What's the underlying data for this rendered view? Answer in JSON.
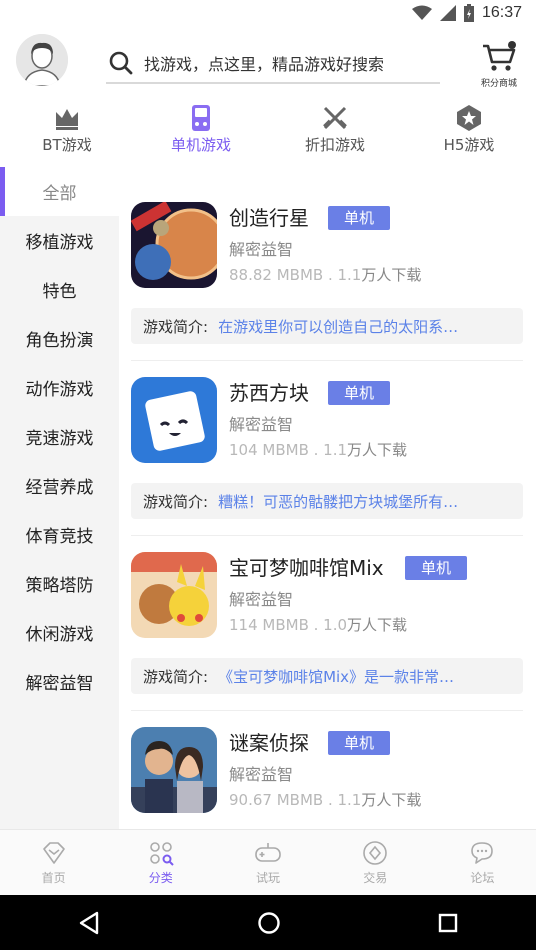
{
  "status": {
    "time": "16:37"
  },
  "header": {
    "search_placeholder": "找游戏，点这里，精品游戏好搜索",
    "cart_label": "积分商城"
  },
  "tabs": [
    {
      "label": "BT游戏",
      "icon": "crown-icon"
    },
    {
      "label": "单机游戏",
      "icon": "gameboy-icon",
      "active": true
    },
    {
      "label": "折扣游戏",
      "icon": "crossed-swords-icon"
    },
    {
      "label": "H5游戏",
      "icon": "hexagon-star-icon"
    }
  ],
  "sidebar": {
    "items": [
      {
        "label": "全部",
        "active": true
      },
      {
        "label": "移植游戏"
      },
      {
        "label": "特色"
      },
      {
        "label": "角色扮演"
      },
      {
        "label": "动作游戏"
      },
      {
        "label": "竞速游戏"
      },
      {
        "label": "经营养成"
      },
      {
        "label": "体育竞技"
      },
      {
        "label": "策略塔防"
      },
      {
        "label": "休闲游戏"
      },
      {
        "label": "解密益智"
      }
    ]
  },
  "games": [
    {
      "title": "创造行星",
      "badge": "单机",
      "category": "解密益智",
      "size": "88.82 MBMB . 1.1",
      "downloads": "万人下载",
      "intro_label": "游戏简介:",
      "intro": "在游戏里你可以创造自己的太阳系…"
    },
    {
      "title": "苏西方块",
      "badge": "单机",
      "category": "解密益智",
      "size": "104 MBMB . 1.1",
      "downloads": "万人下载",
      "intro_label": "游戏简介:",
      "intro": "糟糕！可恶的骷髅把方块城堡所有…"
    },
    {
      "title": "宝可梦咖啡馆Mix",
      "badge": "单机",
      "category": "解密益智",
      "size": "114 MBMB . 1.0",
      "downloads": "万人下载",
      "intro_label": "游戏简介:",
      "intro": "《宝可梦咖啡馆Mix》是一款非常…"
    },
    {
      "title": "谜案侦探",
      "badge": "单机",
      "category": "解密益智",
      "size": "90.67 MBMB . 1.1",
      "downloads": "万人下载"
    }
  ],
  "bottom_nav": [
    {
      "label": "首页",
      "icon": "home-diamond-icon"
    },
    {
      "label": "分类",
      "icon": "category-grid-icon",
      "active": true
    },
    {
      "label": "试玩",
      "icon": "gamepad-icon"
    },
    {
      "label": "交易",
      "icon": "trade-coin-icon"
    },
    {
      "label": "论坛",
      "icon": "chat-bubble-icon"
    }
  ],
  "colors": {
    "accent": "#7b5cf0",
    "badge": "#6a7fe6",
    "intro_link": "#5b82e8"
  }
}
